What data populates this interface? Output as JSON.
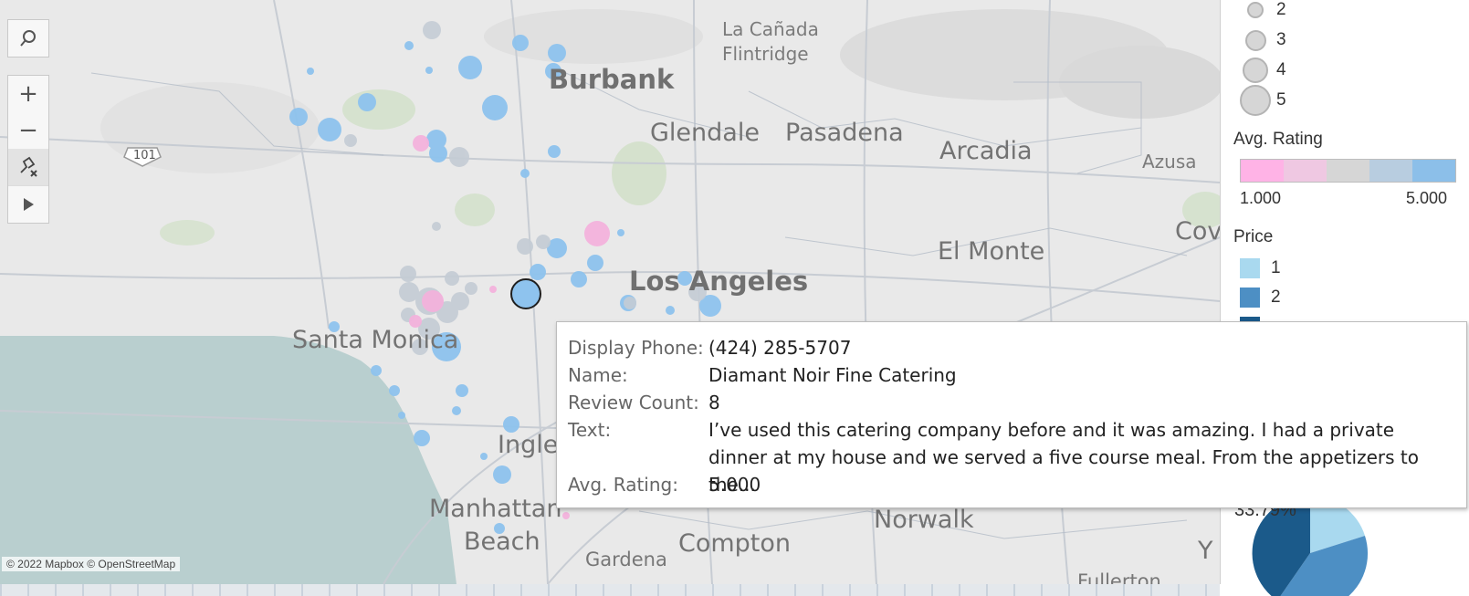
{
  "map": {
    "attribution": "© 2022 Mapbox © OpenStreetMap",
    "places": {
      "burbank": "Burbank",
      "la_canada_1": "La Cañada",
      "la_canada_2": "Flintridge",
      "glendale": "Glendale",
      "pasadena": "Pasadena",
      "arcadia": "Arcadia",
      "azusa": "Azusa",
      "covina": "Covin",
      "el_monte": "El Monte",
      "los_angeles": "Los Angeles",
      "santa_monica": "Santa Monica",
      "inglewood": "Ingle",
      "manhattan": "Manhattan",
      "beach": "Beach",
      "compton": "Compton",
      "gardena": "Gardena",
      "norwalk": "Norwalk",
      "fullerton": "Fullerton",
      "y": "Y",
      "hwy_101": "101"
    },
    "toolbar": {
      "search_icon": "search-icon",
      "zoom_in_label": "+",
      "zoom_out_label": "−",
      "play_icon": "play-icon"
    }
  },
  "legend": {
    "review_count_sizes": [
      "2",
      "3",
      "4",
      "5"
    ],
    "avg_rating_title": "Avg. Rating",
    "avg_rating_min": "1.000",
    "avg_rating_max": "5.000",
    "avg_rating_colors": [
      "#ffb3e6",
      "#efc8e2",
      "#d6d6d6",
      "#b8cde0",
      "#8cbfe9"
    ],
    "price_title": "Price",
    "price_items": [
      {
        "label": "1",
        "color": "#a9d9ef"
      },
      {
        "label": "2",
        "color": "#4d8fc4"
      },
      {
        "label": "",
        "color": "#1b5a8a"
      }
    ],
    "pie_pct": "33.79%"
  },
  "tooltip": {
    "rows": [
      {
        "key": "Display Phone:",
        "value": "(424) 285-5707"
      },
      {
        "key": "Name:",
        "value": "Diamant Noir Fine Catering"
      },
      {
        "key": "Review Count:",
        "value": "8"
      },
      {
        "key": "Text:",
        "value": "I’ve used this catering company before and it was amazing. I had a private dinner at my house and we served a five course meal. From the appetizers to the..."
      },
      {
        "key": "Avg. Rating:",
        "value": "5.000"
      }
    ]
  }
}
